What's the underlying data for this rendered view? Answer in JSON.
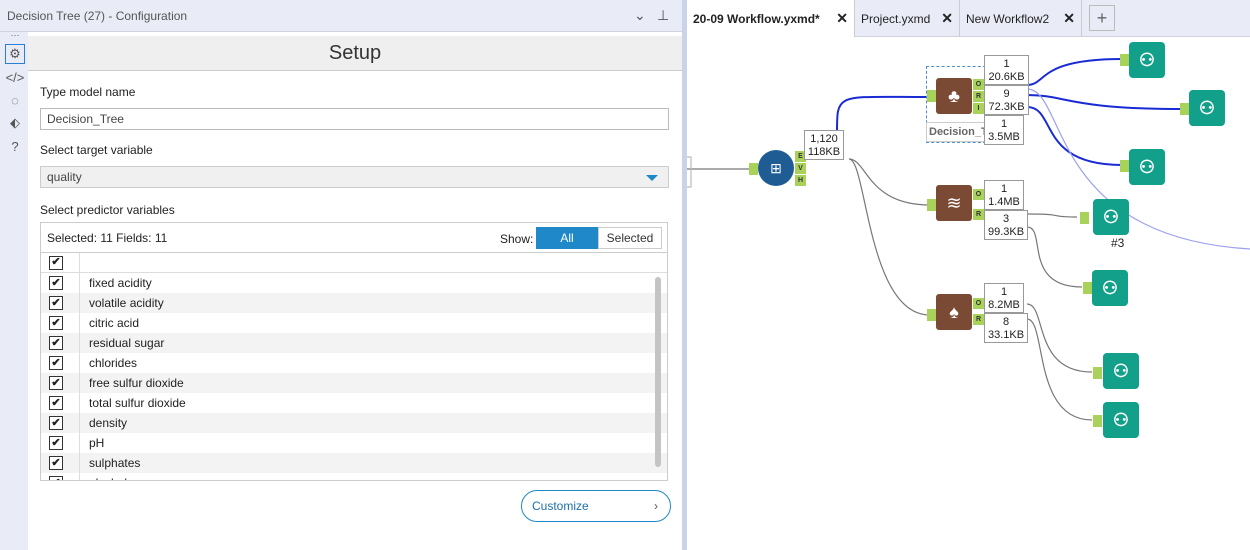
{
  "panel": {
    "title": "Decision Tree (27) - Configuration",
    "header": "Setup",
    "model_name_label": "Type model name",
    "model_name_value": "Decision_Tree",
    "target_label": "Select target variable",
    "target_value": "quality",
    "predictor_label": "Select predictor variables",
    "summary": "Selected: 11 Fields: 11",
    "show_label": "Show:",
    "show_all": "All",
    "show_selected": "Selected",
    "fields": [
      "fixed acidity",
      "volatile acidity",
      "citric acid",
      "residual sugar",
      "chlorides",
      "free sulfur dioxide",
      "total sulfur dioxide",
      "density",
      "pH",
      "sulphates",
      "alcohol"
    ],
    "customize": "Customize"
  },
  "tabs": [
    {
      "label": "20-09 Workflow.yxmd*"
    },
    {
      "label": "Project.yxmd"
    },
    {
      "label": "New Workflow2"
    }
  ],
  "canvas": {
    "sample_box": {
      "records": "1,120",
      "size": "118KB"
    },
    "dt_label": "Decision_Tree",
    "dt_boxes": [
      {
        "records": "1",
        "size": "20.6KB"
      },
      {
        "records": "9",
        "size": "72.3KB"
      },
      {
        "records": "1",
        "size": "3.5MB"
      }
    ],
    "boost_boxes": [
      {
        "records": "1",
        "size": "1.4MB"
      },
      {
        "records": "3",
        "size": "99.3KB"
      }
    ],
    "forest_boxes": [
      {
        "records": "1",
        "size": "8.2MB"
      },
      {
        "records": "8",
        "size": "33.1KB"
      }
    ],
    "comment": "#3"
  }
}
